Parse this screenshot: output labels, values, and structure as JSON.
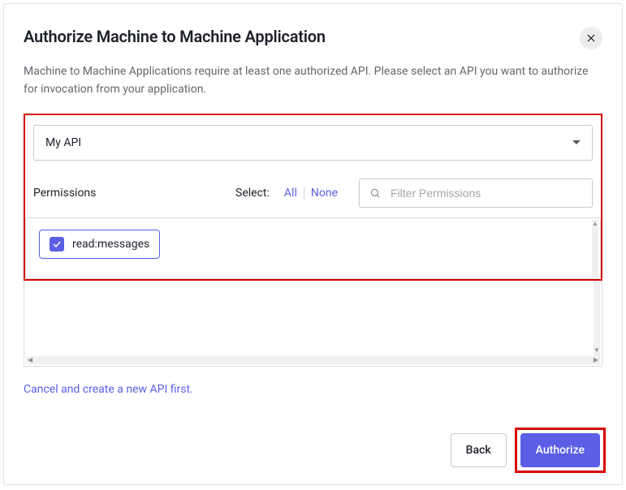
{
  "header": {
    "title": "Authorize Machine to Machine Application"
  },
  "description": "Machine to Machine Applications require at least one authorized API. Please select an API you want to authorize for invocation from your application.",
  "api_select": {
    "value": "My API"
  },
  "permissions": {
    "label": "Permissions",
    "select_label": "Select:",
    "all_label": "All",
    "none_label": "None",
    "filter_placeholder": "Filter Permissions",
    "items": [
      {
        "name": "read:messages",
        "checked": true
      }
    ]
  },
  "cancel_link": "Cancel and create a new API first.",
  "footer": {
    "back_label": "Back",
    "authorize_label": "Authorize"
  }
}
